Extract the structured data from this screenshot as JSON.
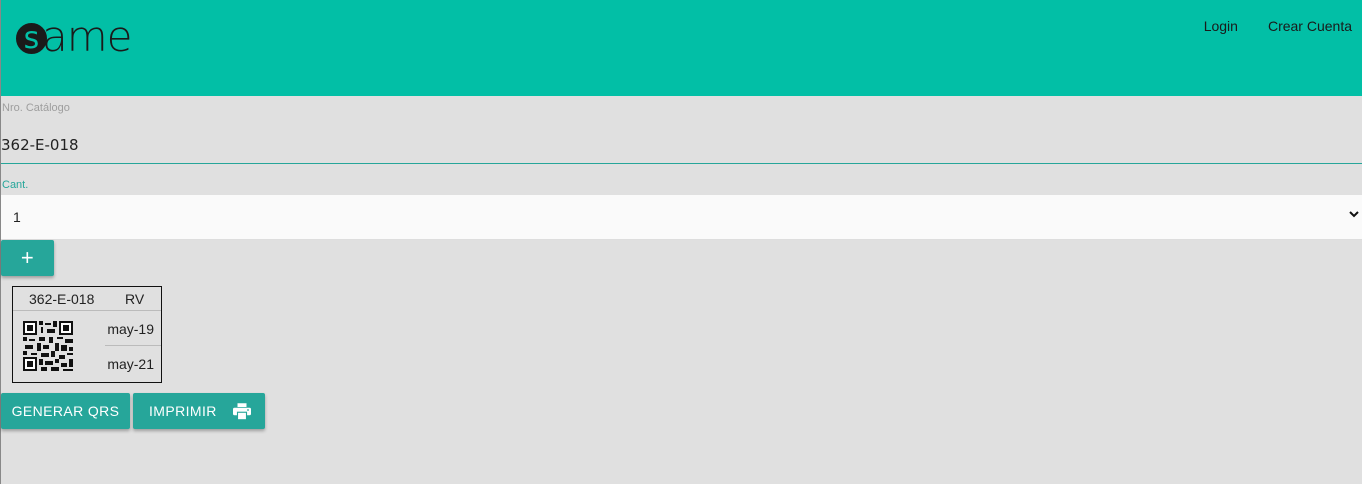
{
  "brand": {
    "logo_letter": "s",
    "logo_rest": "ame"
  },
  "nav": {
    "login": "Login",
    "register": "Crear Cuenta"
  },
  "form": {
    "catalog_label": "Nro. Catálogo",
    "catalog_value": "362-E-018",
    "qty_label": "Cant.",
    "qty_value": "1",
    "add_label": "+"
  },
  "label_card": {
    "code": "362-E-018",
    "suffix": "RV",
    "date_start": "may-19",
    "date_end": "may-21"
  },
  "actions": {
    "generate": "GENERAR QRS",
    "print": "IMPRIMIR"
  },
  "colors": {
    "navbar": "#02bfa6",
    "button": "#26a69a",
    "background": "#e0e0e0"
  },
  "icons": {
    "print": "printer-icon",
    "select": "chevron-down-icon",
    "qr": "qr-code-icon"
  }
}
